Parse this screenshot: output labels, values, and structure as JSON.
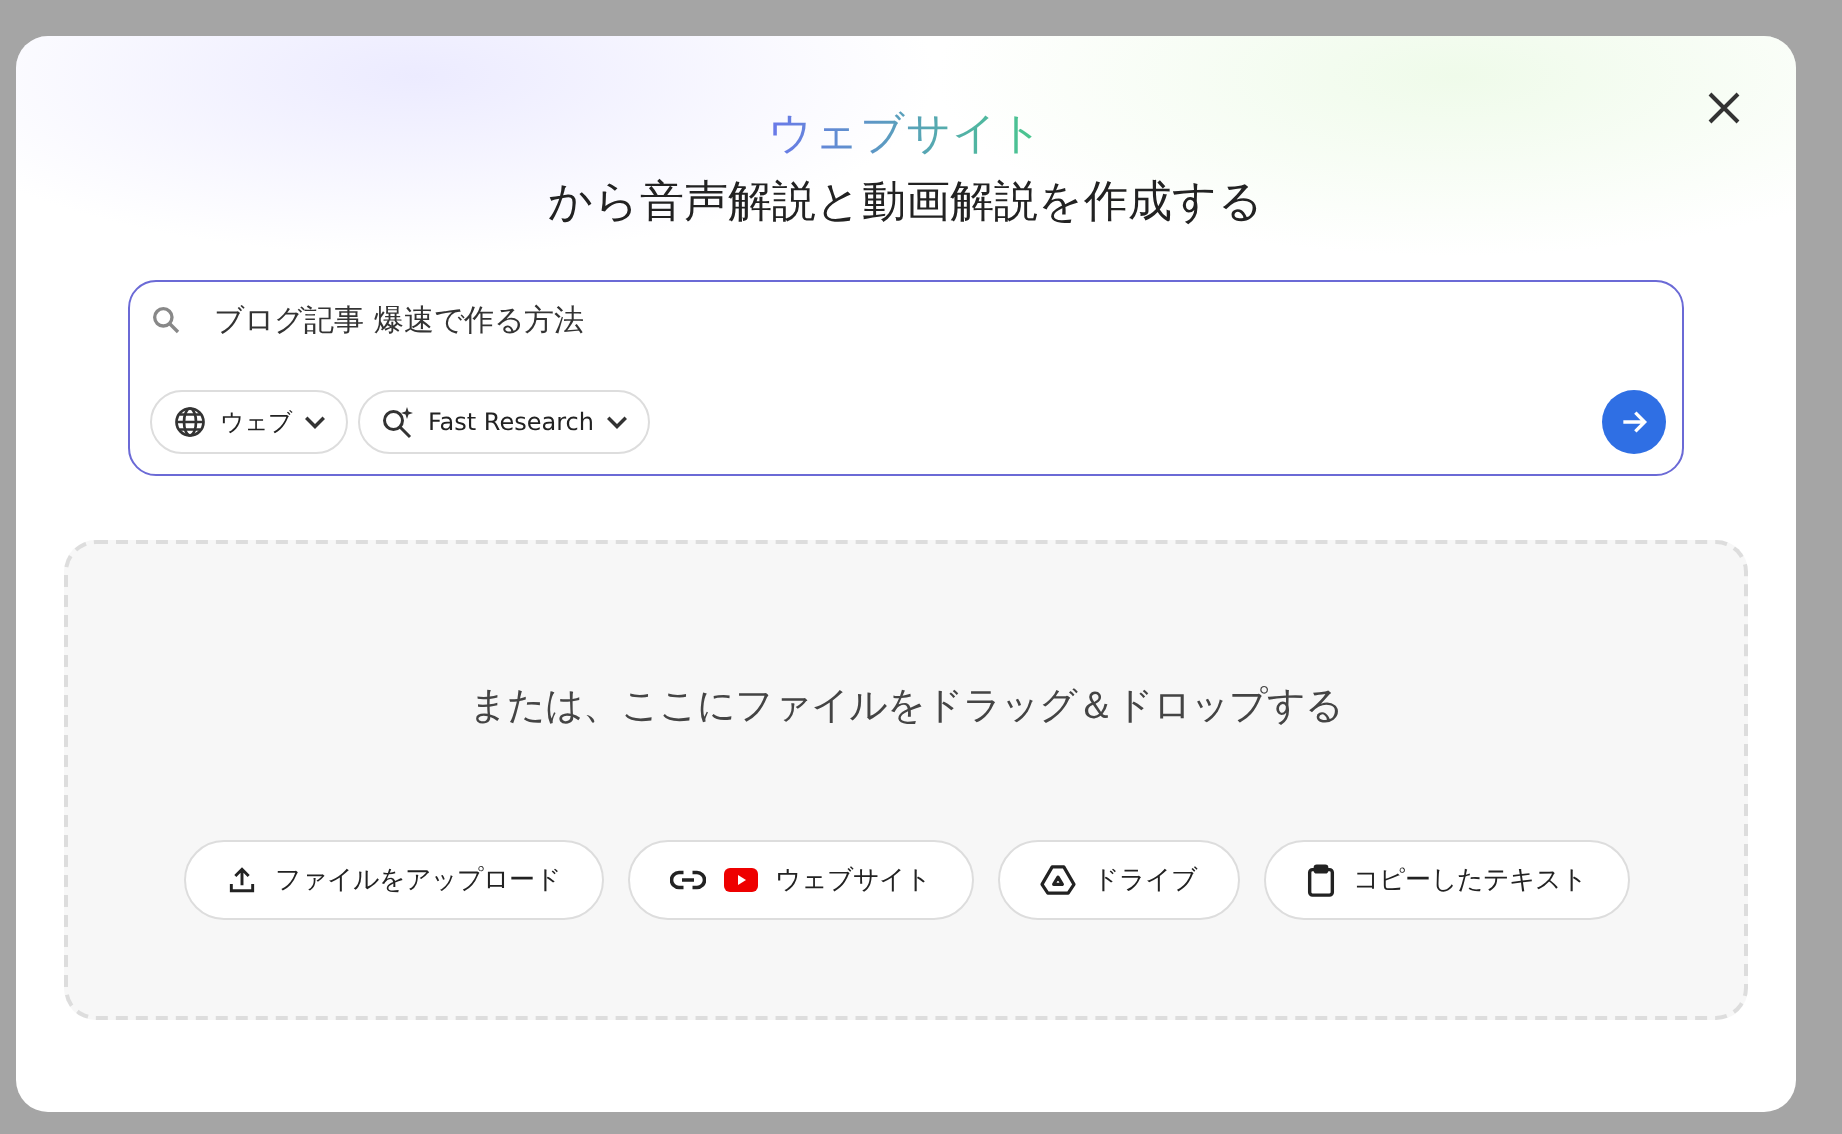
{
  "dialog": {
    "title_highlight": "ウェブサイト",
    "title": "から音声解説と動画解説を作成する"
  },
  "search": {
    "value": "ブログ記事 爆速で作る方法",
    "chips": [
      {
        "kind": "source",
        "label": "ウェブ"
      },
      {
        "kind": "mode",
        "label": "Fast Research"
      }
    ]
  },
  "dropzone": {
    "text": "または、ここにファイルをドラッグ＆ドロップする",
    "buttons": [
      {
        "kind": "upload",
        "label": "ファイルをアップロード"
      },
      {
        "kind": "website",
        "label": "ウェブサイト"
      },
      {
        "kind": "drive",
        "label": "ドライブ"
      },
      {
        "kind": "clipboard",
        "label": "コピーしたテキスト"
      }
    ]
  }
}
